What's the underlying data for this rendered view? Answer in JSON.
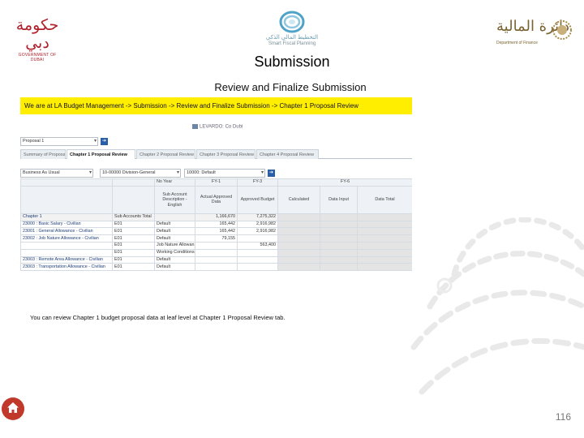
{
  "header": {
    "logo_left": {
      "arabic": "حكومة دبي",
      "english": "GOVERNMENT OF DUBAI"
    },
    "logo_center": {
      "arabic": "التخطيط المالي الذكي",
      "english": "Smart Fiscal Planning"
    },
    "logo_right": {
      "arabic": "دائرة المالية",
      "english": "Department of Finance"
    }
  },
  "slide": {
    "title": "Submission",
    "subtitle": "Review and Finalize Submission",
    "caption": "You can review Chapter 1 budget proposal data at leaf level at Chapter 1 Proposal Review tab.",
    "page_number": "116"
  },
  "screen": {
    "breadcrumb": "We are at LA Budget Management -> Submission -> Review and Finalize Submission -> Chapter 1 Proposal Review",
    "workspace_title": "LEVARDO: Co Dubi",
    "top_select": "Proposal 1",
    "tabs": [
      "Summary of Proposal",
      "Chapter 1 Proposal Review",
      "Chapter 2 Proposal Review",
      "Chapter 3 Proposal Review",
      "Chapter 4 Proposal Review"
    ],
    "active_tab": 1,
    "pov": {
      "label": "Business As Usual",
      "entity": "10-00000 Division-General",
      "fund": "10000: Default"
    },
    "grid": {
      "group_headers": [
        "No Year",
        "FY-1",
        "FY-3",
        "FY-6"
      ],
      "columns": [
        "",
        "",
        "Sub Account Description - English",
        "Actual Approved Data",
        "Approved Budget",
        "Calculated",
        "Data Input",
        "Data Total"
      ],
      "total_row": {
        "name": "Chapter 1",
        "sub": "Sub Accounts Total",
        "fy1": "1,166,670",
        "fy3": "7,275,322"
      },
      "rows": [
        {
          "name": "23000 : Basic Salary - Civilian",
          "sub": "E01",
          "desc": "Default",
          "fy1": "165,442",
          "fy3": "2,916,982"
        },
        {
          "name": "23001 : General Allowance - Civilian",
          "sub": "E01",
          "desc": "Default",
          "fy1": "165,442",
          "fy3": "2,916,982"
        },
        {
          "name": "23002 : Job Nature Allowance - Civilian",
          "sub": "E01",
          "desc": "Default",
          "fy1": "79,155",
          "fy3": ""
        },
        {
          "name": "",
          "sub": "E01",
          "desc": "Job Nature Allowan",
          "fy1": "",
          "fy3": "563,400"
        },
        {
          "name": "",
          "sub": "E01",
          "desc": "Working Conditions",
          "fy1": "",
          "fy3": ""
        },
        {
          "name": "23003 : Remote Area Allowance - Civilian",
          "sub": "E01",
          "desc": "Default",
          "fy1": "",
          "fy3": ""
        },
        {
          "name": "23003 : Transportation Allowance - Civilian",
          "sub": "E01",
          "desc": "Default",
          "fy1": "",
          "fy3": ""
        }
      ]
    }
  },
  "colors": {
    "breadcrumb_bg": "#ffee00",
    "home_button": "#c0392b",
    "logo_red": "#b0202b",
    "logo_gold": "#7a6230"
  },
  "icons": [
    "home-icon",
    "go-arrow-icon",
    "dropdown-caret-icon",
    "dof-emblem-icon",
    "sfp-ring-icon"
  ]
}
